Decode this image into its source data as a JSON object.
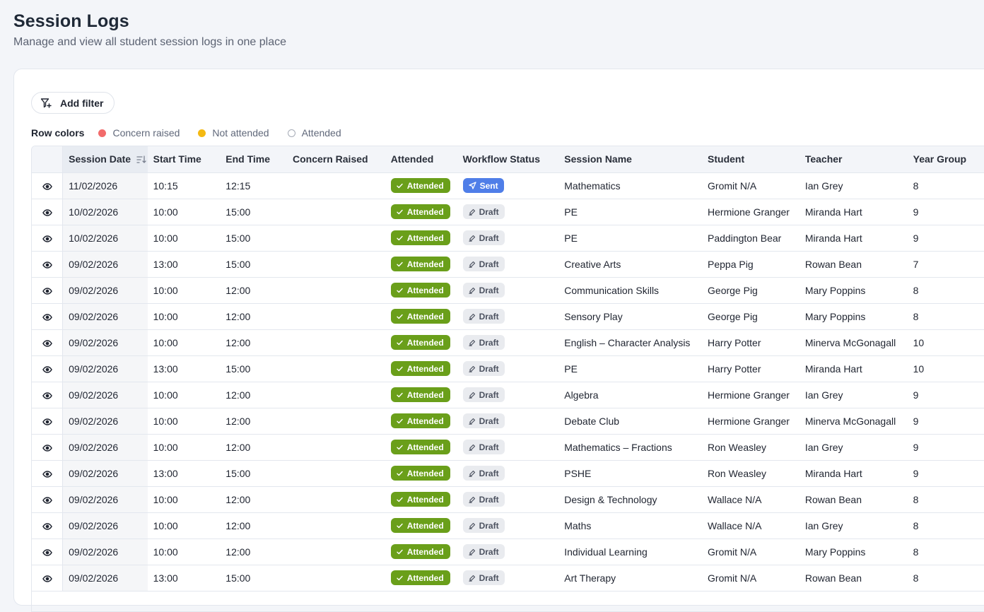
{
  "header": {
    "title": "Session Logs",
    "subtitle": "Manage and view all student session logs in one place"
  },
  "toolbar": {
    "add_filter_label": "Add filter"
  },
  "legend": {
    "title": "Row colors",
    "items": [
      {
        "label": "Concern raised",
        "color": "#f26b6b"
      },
      {
        "label": "Not attended",
        "color": "#f4b912"
      },
      {
        "label": "Attended",
        "color": "#ffffff"
      }
    ]
  },
  "table": {
    "columns": [
      "Session Date",
      "Start Time",
      "End Time",
      "Concern Raised",
      "Attended",
      "Workflow Status",
      "Session Name",
      "Student",
      "Teacher",
      "Year Group"
    ],
    "rows": [
      {
        "date": "11/02/2026",
        "start": "10:15",
        "end": "12:15",
        "concern": "",
        "attended": "Attended",
        "status": "Sent",
        "status_type": "sent",
        "session": "Mathematics",
        "student": "Gromit N/A",
        "teacher": "Ian Grey",
        "year": "8"
      },
      {
        "date": "10/02/2026",
        "start": "10:00",
        "end": "15:00",
        "concern": "",
        "attended": "Attended",
        "status": "Draft",
        "status_type": "draft",
        "session": "PE",
        "student": "Hermione Granger",
        "teacher": "Miranda Hart",
        "year": "9"
      },
      {
        "date": "10/02/2026",
        "start": "10:00",
        "end": "15:00",
        "concern": "",
        "attended": "Attended",
        "status": "Draft",
        "status_type": "draft",
        "session": "PE",
        "student": "Paddington Bear",
        "teacher": "Miranda Hart",
        "year": "9"
      },
      {
        "date": "09/02/2026",
        "start": "13:00",
        "end": "15:00",
        "concern": "",
        "attended": "Attended",
        "status": "Draft",
        "status_type": "draft",
        "session": "Creative Arts",
        "student": "Peppa Pig",
        "teacher": "Rowan Bean",
        "year": "7"
      },
      {
        "date": "09/02/2026",
        "start": "10:00",
        "end": "12:00",
        "concern": "",
        "attended": "Attended",
        "status": "Draft",
        "status_type": "draft",
        "session": "Communication Skills",
        "student": "George Pig",
        "teacher": "Mary Poppins",
        "year": "8"
      },
      {
        "date": "09/02/2026",
        "start": "10:00",
        "end": "12:00",
        "concern": "",
        "attended": "Attended",
        "status": "Draft",
        "status_type": "draft",
        "session": "Sensory Play",
        "student": "George Pig",
        "teacher": "Mary Poppins",
        "year": "8"
      },
      {
        "date": "09/02/2026",
        "start": "10:00",
        "end": "12:00",
        "concern": "",
        "attended": "Attended",
        "status": "Draft",
        "status_type": "draft",
        "session": "English – Character Analysis",
        "student": "Harry Potter",
        "teacher": "Minerva McGonagall",
        "year": "10"
      },
      {
        "date": "09/02/2026",
        "start": "13:00",
        "end": "15:00",
        "concern": "",
        "attended": "Attended",
        "status": "Draft",
        "status_type": "draft",
        "session": "PE",
        "student": "Harry Potter",
        "teacher": "Miranda Hart",
        "year": "10"
      },
      {
        "date": "09/02/2026",
        "start": "10:00",
        "end": "12:00",
        "concern": "",
        "attended": "Attended",
        "status": "Draft",
        "status_type": "draft",
        "session": "Algebra",
        "student": "Hermione Granger",
        "teacher": "Ian Grey",
        "year": "9"
      },
      {
        "date": "09/02/2026",
        "start": "10:00",
        "end": "12:00",
        "concern": "",
        "attended": "Attended",
        "status": "Draft",
        "status_type": "draft",
        "session": "Debate Club",
        "student": "Hermione Granger",
        "teacher": "Minerva McGonagall",
        "year": "9"
      },
      {
        "date": "09/02/2026",
        "start": "10:00",
        "end": "12:00",
        "concern": "",
        "attended": "Attended",
        "status": "Draft",
        "status_type": "draft",
        "session": "Mathematics – Fractions",
        "student": "Ron Weasley",
        "teacher": "Ian Grey",
        "year": "9"
      },
      {
        "date": "09/02/2026",
        "start": "13:00",
        "end": "15:00",
        "concern": "",
        "attended": "Attended",
        "status": "Draft",
        "status_type": "draft",
        "session": "PSHE",
        "student": "Ron Weasley",
        "teacher": "Miranda Hart",
        "year": "9"
      },
      {
        "date": "09/02/2026",
        "start": "10:00",
        "end": "12:00",
        "concern": "",
        "attended": "Attended",
        "status": "Draft",
        "status_type": "draft",
        "session": "Design & Technology",
        "student": "Wallace N/A",
        "teacher": "Rowan Bean",
        "year": "8"
      },
      {
        "date": "09/02/2026",
        "start": "10:00",
        "end": "12:00",
        "concern": "",
        "attended": "Attended",
        "status": "Draft",
        "status_type": "draft",
        "session": "Maths",
        "student": "Wallace N/A",
        "teacher": "Ian Grey",
        "year": "8"
      },
      {
        "date": "09/02/2026",
        "start": "10:00",
        "end": "12:00",
        "concern": "",
        "attended": "Attended",
        "status": "Draft",
        "status_type": "draft",
        "session": "Individual Learning",
        "student": "Gromit N/A",
        "teacher": "Mary Poppins",
        "year": "8"
      },
      {
        "date": "09/02/2026",
        "start": "13:00",
        "end": "15:00",
        "concern": "",
        "attended": "Attended",
        "status": "Draft",
        "status_type": "draft",
        "session": "Art Therapy",
        "student": "Gromit N/A",
        "teacher": "Rowan Bean",
        "year": "8"
      }
    ]
  },
  "icons": {
    "filter": "filter-plus-icon",
    "sort": "sort-descending-icon",
    "view": "eye-icon",
    "check": "check-icon",
    "sent": "send-icon",
    "draft": "edit-icon"
  },
  "colors": {
    "attended_badge": "#6a9f1a",
    "sent_badge": "#4f7ee8",
    "draft_badge": "#e9ebef"
  }
}
